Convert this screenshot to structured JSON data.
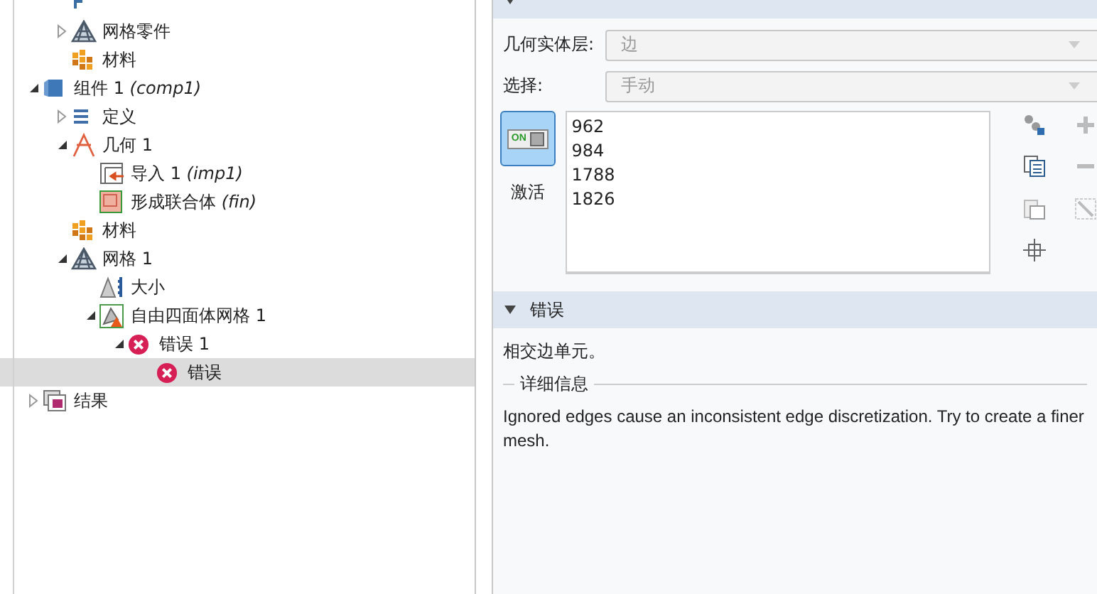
{
  "tree": {
    "scrolled_items": [
      {
        "kind": "param"
      },
      {
        "label": "网格零件",
        "kind": "mesh",
        "expanded": false
      },
      {
        "label": "材料",
        "kind": "material"
      }
    ],
    "items": [
      {
        "label": "组件 1",
        "tag": "(comp1)",
        "kind": "component",
        "expanded": true,
        "selected": false,
        "children": [
          {
            "label": "定义",
            "kind": "definitions",
            "expanded": false,
            "selected": false
          },
          {
            "label": "几何 1",
            "kind": "geometry",
            "expanded": true,
            "selected": false,
            "children": [
              {
                "label": "导入 1",
                "tag": "(imp1)",
                "kind": "import",
                "selected": false
              },
              {
                "label": "形成联合体",
                "tag": "(fin)",
                "kind": "union",
                "selected": false
              }
            ]
          },
          {
            "label": "材料",
            "kind": "material",
            "selected": false
          },
          {
            "label": "网格 1",
            "kind": "mesh",
            "expanded": true,
            "selected": false,
            "children": [
              {
                "label": "大小",
                "kind": "size",
                "selected": false
              },
              {
                "label": "自由四面体网格 1",
                "kind": "tetra",
                "expanded": true,
                "selected": false,
                "children": [
                  {
                    "label": "错误 1",
                    "kind": "error",
                    "expanded": true,
                    "selected": false,
                    "children": [
                      {
                        "label": "错误",
                        "kind": "error",
                        "selected": true
                      }
                    ]
                  }
                ]
              }
            ]
          }
        ]
      },
      {
        "label": "结果",
        "kind": "results",
        "expanded": false,
        "selected": false
      }
    ]
  },
  "selection_section": {
    "expanded": true,
    "fields": [
      {
        "label": "几何实体层:",
        "value": "边",
        "disabled": true
      },
      {
        "label": "选择:",
        "value": "手动",
        "disabled": true
      }
    ],
    "toggle": {
      "switch_text": "ON",
      "on": true,
      "label": "激活"
    },
    "entities": [
      "962",
      "984",
      "1788",
      "1826"
    ]
  },
  "error_section": {
    "title": "错误",
    "expanded": true,
    "summary": "相交边单元。",
    "details_title": "详细信息",
    "message": "Ignored edges cause an inconsistent edge discretization. Try to create a finer mesh."
  }
}
